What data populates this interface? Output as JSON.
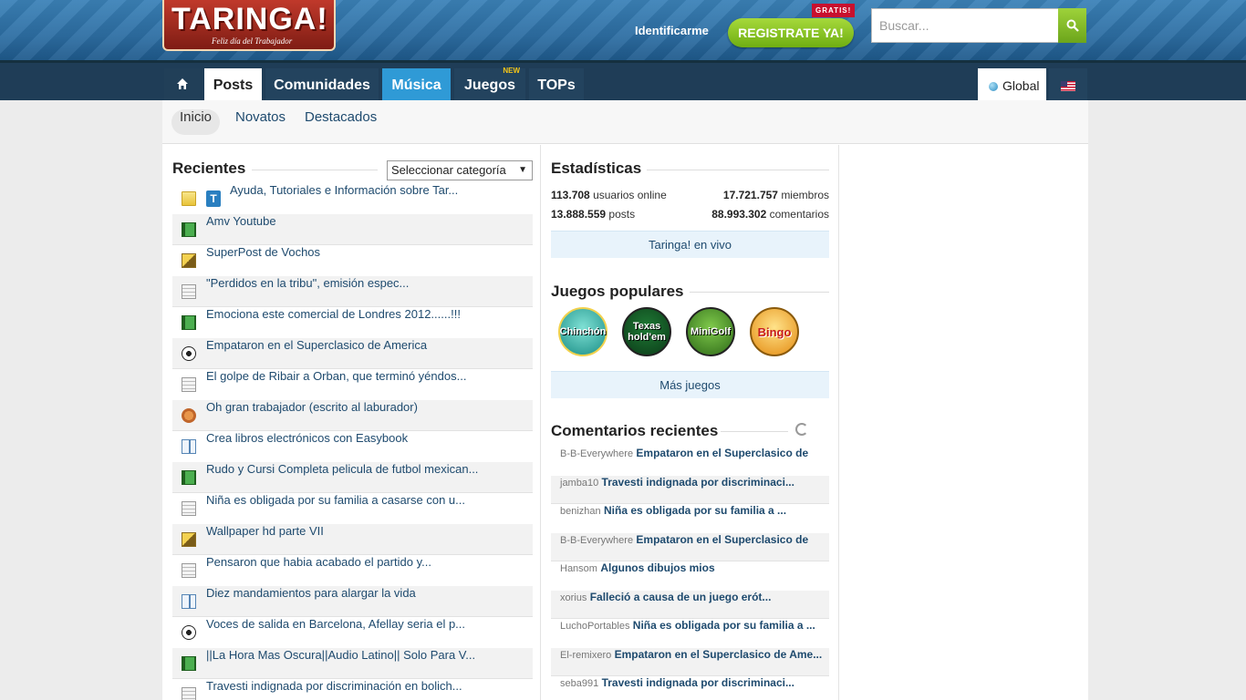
{
  "header": {
    "logo_text": "TARINGA!",
    "logo_subtitle": "Feliz día del Trabajador",
    "login_label": "Identificarme",
    "register_label": "REGISTRATE YA!",
    "register_badge": "GRATIS!",
    "search_placeholder": "Buscar..."
  },
  "nav": {
    "home_icon": "home-icon",
    "items": [
      {
        "label": "Posts"
      },
      {
        "label": "Comunidades"
      },
      {
        "label": "Música"
      },
      {
        "label": "Juegos",
        "badge": "NEW"
      },
      {
        "label": "TOPs"
      }
    ],
    "global_label": "Global",
    "flag_icon": "us-flag-icon"
  },
  "subnav": {
    "items": [
      {
        "label": "Inicio"
      },
      {
        "label": "Novatos"
      },
      {
        "label": "Destacados"
      }
    ]
  },
  "recientes": {
    "title": "Recientes",
    "category_select": "Seleccionar categoría",
    "posts": [
      {
        "icon": "folder-icon",
        "title": "Ayuda, Tutoriales e Información sobre Tar..."
      },
      {
        "icon": "film-icon",
        "title": "Amv Youtube"
      },
      {
        "icon": "image-icon",
        "title": "SuperPost de Vochos"
      },
      {
        "icon": "document-icon",
        "title": "\"Perdidos en la tribu\", emisión espec..."
      },
      {
        "icon": "film-icon",
        "title": "Emociona este comercial de Londres 2012......!!!"
      },
      {
        "icon": "soccer-ball-icon",
        "title": "Empataron en el Superclasico de America"
      },
      {
        "icon": "document-icon",
        "title": "El golpe de Ribair a Orban, que terminó yéndos..."
      },
      {
        "icon": "food-icon",
        "title": "Oh gran trabajador (escrito al laburador)"
      },
      {
        "icon": "book-icon",
        "title": "Crea libros electrónicos con Easybook"
      },
      {
        "icon": "film-icon",
        "title": "Rudo y Cursi Completa pelicula de futbol mexican..."
      },
      {
        "icon": "document-icon",
        "title": "Niña es obligada por su familia a casarse con u..."
      },
      {
        "icon": "image-icon",
        "title": "Wallpaper hd parte VII"
      },
      {
        "icon": "document-icon",
        "title": "Pensaron que habia acabado el partido y..."
      },
      {
        "icon": "book-icon",
        "title": "Diez mandamientos para alargar la vida"
      },
      {
        "icon": "soccer-ball-icon",
        "title": "Voces de salida en Barcelona, Afellay seria el p..."
      },
      {
        "icon": "film-icon",
        "title": "||La Hora Mas Oscura||Audio Latino|| Solo Para V..."
      },
      {
        "icon": "document-icon",
        "title": "Travesti indignada por discriminación en bolich..."
      }
    ]
  },
  "estadisticas": {
    "title": "Estadísticas",
    "online_value": "113.708",
    "online_label": "usuarios online",
    "members_value": "17.721.757",
    "members_label": "miembros",
    "posts_value": "13.888.559",
    "posts_label": "posts",
    "comments_value": "88.993.302",
    "comments_label": "comentarios",
    "live_label": "Taringa! en vivo"
  },
  "juegos": {
    "title": "Juegos populares",
    "games": [
      {
        "name": "Chinchón"
      },
      {
        "name": "Texas hold'em"
      },
      {
        "name": "MiniGolf"
      },
      {
        "name": "Bingo"
      }
    ],
    "more_label": "Más juegos"
  },
  "comentarios": {
    "title": "Comentarios recientes",
    "items": [
      {
        "user": "B-B-Everywhere",
        "title": "Empataron en el Superclasico de"
      },
      {
        "user": "jamba10",
        "title": "Travesti indignada por discriminaci..."
      },
      {
        "user": "benizhan",
        "title": "Niña es obligada por su familia a ..."
      },
      {
        "user": "B-B-Everywhere",
        "title": "Empataron en el Superclasico de"
      },
      {
        "user": "Hansom",
        "title": "Algunos dibujos mios"
      },
      {
        "user": "xorius",
        "title": "Falleció a causa de un juego erót..."
      },
      {
        "user": "LuchoPortables",
        "title": "Niña es obligada por su familia a ..."
      },
      {
        "user": "El-remixero",
        "title": "Empataron en el Superclasico de Ame..."
      },
      {
        "user": "seba991",
        "title": "Travesti indignada por discriminaci..."
      }
    ]
  }
}
